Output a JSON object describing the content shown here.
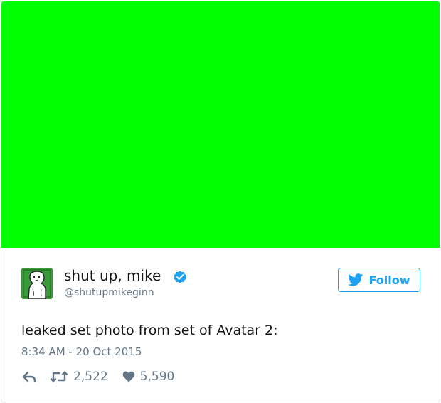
{
  "media": {
    "background_color": "#00ff00"
  },
  "author": {
    "display_name": "shut up, mike",
    "handle": "@shutupmikeginn",
    "verified": true,
    "avatar_icon": "avatar-drawing-icon",
    "avatar_background_color": "#3a9b3a"
  },
  "follow_button": {
    "label": "Follow",
    "icon": "twitter-bird-icon",
    "color": "#1da1f2"
  },
  "tweet": {
    "text": "leaked set photo from set of Avatar 2:",
    "timestamp": "8:34 AM - 20 Oct 2015"
  },
  "actions": {
    "reply_icon": "reply-icon",
    "retweet_icon": "retweet-icon",
    "retweet_count": "2,522",
    "like_icon": "heart-icon",
    "like_count": "5,590"
  },
  "colors": {
    "text_primary": "#14171a",
    "text_secondary": "#657786",
    "verified_badge": "#1da1f2",
    "border": "#e1e8ed"
  }
}
